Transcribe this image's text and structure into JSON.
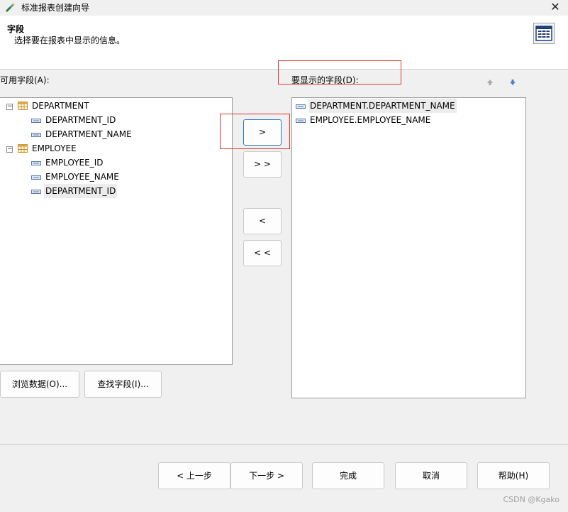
{
  "window": {
    "title": "标准报表创建向导",
    "close_glyph": "✕"
  },
  "header": {
    "title": "字段",
    "description": "选择要在报表中显示的信息。"
  },
  "available": {
    "label": "可用字段(A):",
    "tree": [
      {
        "name": "DEPARTMENT",
        "fields": [
          "DEPARTMENT_ID",
          "DEPARTMENT_NAME"
        ]
      },
      {
        "name": "EMPLOYEE",
        "fields": [
          "EMPLOYEE_ID",
          "EMPLOYEE_NAME",
          "DEPARTMENT_ID"
        ]
      }
    ]
  },
  "display": {
    "label": "要显示的字段(D):",
    "fields": [
      "DEPARTMENT.DEPARTMENT_NAME",
      "EMPLOYEE.EMPLOYEE_NAME"
    ]
  },
  "move_buttons": {
    "add": ">",
    "add_all": "> >",
    "remove": "<",
    "remove_all": "< <"
  },
  "actions": {
    "browse": "浏览数据(O)...",
    "find": "查找字段(I)..."
  },
  "footer": {
    "back": "< 上一步",
    "next": "下一步 >",
    "finish": "完成",
    "cancel": "取消",
    "help": "帮助(H)"
  },
  "watermark": "CSDN @Kgako",
  "colors": {
    "accent": "#2a78c4",
    "highlight_box": "#e53232",
    "table_icon": "#d9a441"
  }
}
